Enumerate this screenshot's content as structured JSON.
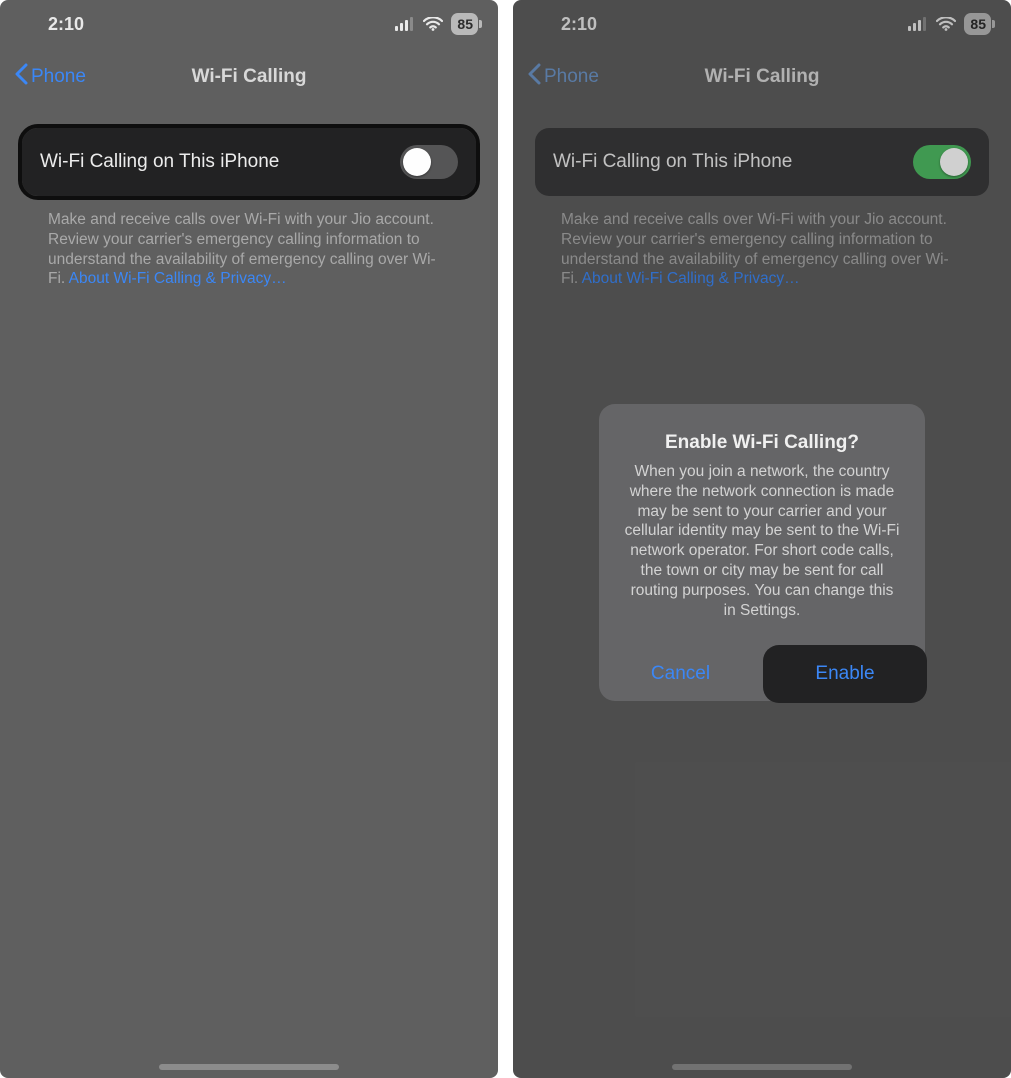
{
  "status": {
    "time": "2:10",
    "battery": "85"
  },
  "nav": {
    "back_label": "Phone",
    "title": "Wi-Fi Calling"
  },
  "row": {
    "label": "Wi-Fi Calling on This iPhone"
  },
  "footer": {
    "text": "Make and receive calls over Wi-Fi with your Jio account. Review your carrier's emergency calling information to understand the availability of emergency calling over Wi-Fi. ",
    "link": "About Wi-Fi Calling & Privacy…"
  },
  "alert": {
    "title": "Enable Wi-Fi Calling?",
    "message": "When you join a network, the country where the network connection is made may be sent to your carrier and your cellular identity may be sent to the Wi-Fi network operator. For short code calls, the town or city may be sent for call routing purposes. You can change this in Settings.",
    "cancel": "Cancel",
    "enable": "Enable"
  },
  "colors": {
    "accent": "#3b87f6",
    "toggle_on": "#4fbb63"
  }
}
